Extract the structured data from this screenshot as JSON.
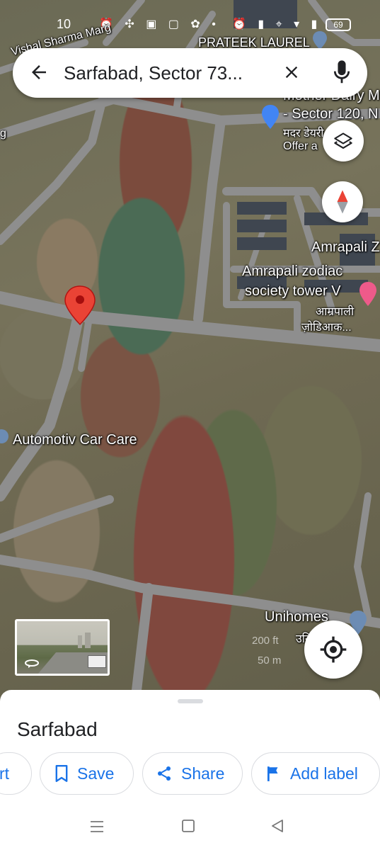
{
  "status_bar": {
    "time": "10",
    "left_icons": "⏰ ✣ ▣ ▢ ✿ •",
    "right_icons": "⏰ ▮ ⌖ ▾ ▮",
    "battery": "69"
  },
  "search": {
    "query": "Sarfabad, Sector 73...",
    "back_icon": "arrow-back",
    "clear_icon": "close",
    "mic_icon": "microphone"
  },
  "map_labels": {
    "road": "Vishal Sharma Marg",
    "prateek": "PRATEEK LAUREL",
    "mother_dairy_1": "Mother Dairy M",
    "mother_dairy_2": "- Sector 120, N",
    "mother_dairy_3": "मदर डेयरी",
    "mother_dairy_4": "Offer a",
    "amrapali_z": "Amrapali Z",
    "amrapali_zodiac_1": "Amrapali zodiac",
    "amrapali_zodiac_2": "society tower V",
    "amrapali_hindi_1": "आम्रपाली",
    "amrapali_hindi_2": "ज़ोडिआक...",
    "car_care": "Automotiv Car Care",
    "unihomes": "Unihomes",
    "unihomes_hindi": "उनि",
    "scale_ft": "200 ft",
    "scale_m": "50 m",
    "edge_g": "g"
  },
  "bottom_sheet": {
    "place_name": "Sarfabad",
    "actions": {
      "route": "rt",
      "save": "Save",
      "share": "Share",
      "add_label": "Add label"
    }
  },
  "colors": {
    "accent": "#1a73e8",
    "pin": "#ea4335",
    "road": "#9a9a9a"
  }
}
